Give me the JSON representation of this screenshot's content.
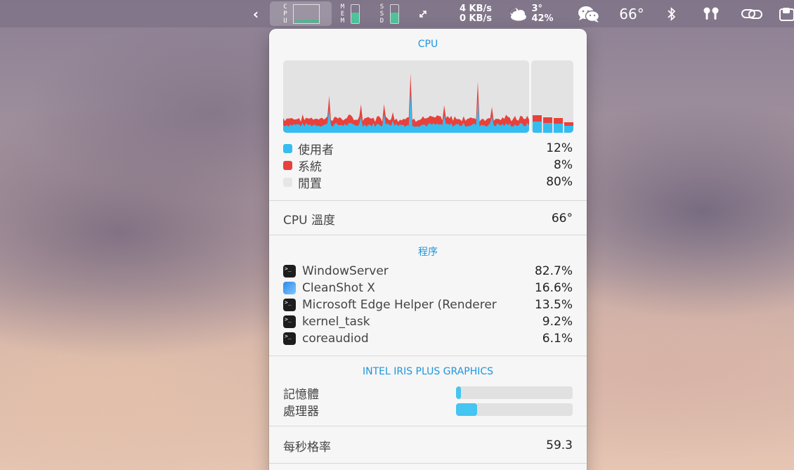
{
  "menubar": {
    "chevron": "‹",
    "cpu_label": "C\nP\nU",
    "mem_label": "M\nE\nM",
    "ssd_label": "S\nS\nD",
    "mem_level": 0.55,
    "ssd_level": 0.55,
    "network_icon": "arrows-icon",
    "upload_speed": "4 KB/s",
    "download_speed": "0 KB/s",
    "weather_temp": "3°",
    "weather_humidity": "42%",
    "cpu_temp": "66°",
    "bluetooth_icon": "bluetooth-icon",
    "airpods_icon": "airpods-icon"
  },
  "panel": {
    "cpu": {
      "title": "CPU",
      "legend": [
        {
          "label": "使用者",
          "value": "12%",
          "color": "#36bdf0"
        },
        {
          "label": "系統",
          "value": "8%",
          "color": "#e8413c"
        },
        {
          "label": "閒置",
          "value": "80%",
          "color": "#e6e6e6"
        }
      ],
      "temperature_label": "CPU 溫度",
      "temperature_value": "66°",
      "core_bars": [
        {
          "user": 0.16,
          "system": 0.08
        },
        {
          "user": 0.14,
          "system": 0.07
        },
        {
          "user": 0.13,
          "system": 0.07
        },
        {
          "user": 0.1,
          "system": 0.05
        }
      ]
    },
    "processes": {
      "title": "程序",
      "items": [
        {
          "name": "WindowServer",
          "value": "82.7%",
          "icon": "terminal"
        },
        {
          "name": "CleanShot X",
          "value": "16.6%",
          "icon": "cleanshot"
        },
        {
          "name": "Microsoft Edge Helper (Renderer",
          "value": "13.5%",
          "icon": "terminal"
        },
        {
          "name": "kernel_task",
          "value": "9.2%",
          "icon": "terminal"
        },
        {
          "name": "coreaudiod",
          "value": "6.1%",
          "icon": "terminal"
        }
      ]
    },
    "gpu": {
      "title": "INTEL IRIS PLUS GRAPHICS",
      "memory_label": "記憶體",
      "memory_level": 0.04,
      "processor_label": "處理器",
      "processor_level": 0.18,
      "fps_label": "每秒格率",
      "fps_value": "59.3"
    }
  }
}
